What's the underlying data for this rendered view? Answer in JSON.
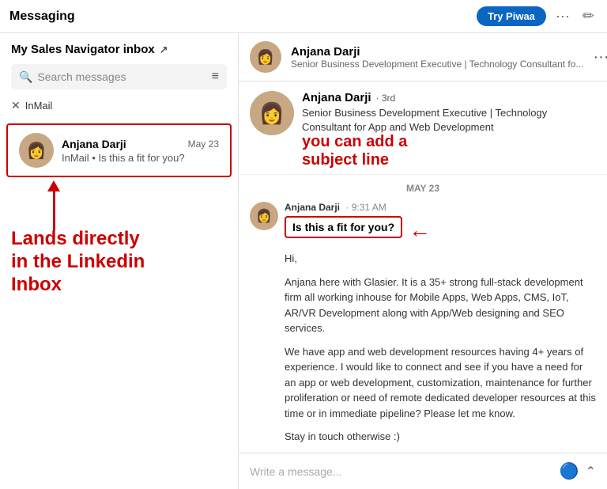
{
  "header": {
    "title": "Messaging",
    "try_btn": "Try Piwaa",
    "dots": "···",
    "compose_icon": "✏"
  },
  "left_panel": {
    "title": "My Sales Navigator inbox",
    "external_link_icon": "↗",
    "search_placeholder": "Search messages",
    "filter_icon": "≡",
    "filter_label": "InMail",
    "close_icon": "✕",
    "conversation": {
      "name": "Anjana Darji",
      "date": "May 23",
      "tag": "InMail",
      "snippet": "Is this a fit for you?"
    }
  },
  "annotation_left": {
    "text": "Lands directly\nin the Linkedin\nInbox"
  },
  "right_panel": {
    "header": {
      "name": "Anjana Darji",
      "subtitle": "Senior Business Development Executive | Technology Consultant fo...",
      "dots": "···"
    },
    "profile": {
      "name": "Anjana Darji",
      "degree": "· 3rd",
      "title": "Senior Business Development Executive | Technology Consultant for App and Web Development"
    },
    "annotation_right": {
      "text": "you can add a\nsubject line"
    },
    "message_date": "MAY 23",
    "message": {
      "sender": "Anjana Darji",
      "time": "· 9:31 AM",
      "subject": "Is this a fit for you?",
      "body_1": "Hi,",
      "body_2": "Anjana here with Glasier. It is a 35+ strong full-stack development firm all working inhouse for Mobile Apps, Web Apps, CMS, IoT, AR/VR Development along with App/Web designing and SEO services.",
      "body_3": "We have app and web development resources having 4+ years of experience. I would like to connect and see if you have a need for an app or web development, customization, maintenance for further proliferation or need of remote dedicated developer resources at this time or in immediate pipeline? Please let me know.",
      "body_4": "Stay in touch otherwise :)"
    },
    "write_placeholder": "Write a message..."
  }
}
